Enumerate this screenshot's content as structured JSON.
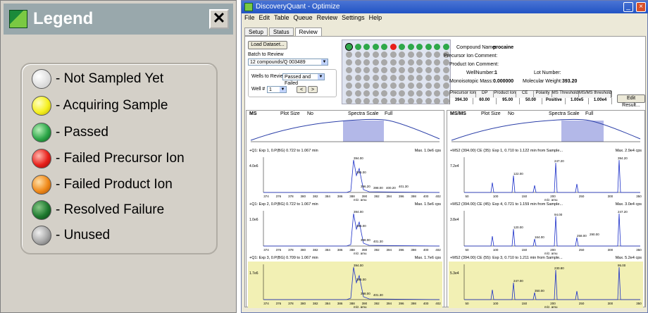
{
  "legend": {
    "title": "Legend",
    "close": "✕",
    "items": [
      {
        "label": "- Not Sampled Yet",
        "color": "#ffffff"
      },
      {
        "label": "- Acquiring Sample",
        "color": "#f5f020"
      },
      {
        "label": "- Passed",
        "color": "#2ea84a"
      },
      {
        "label": "- Failed Precursor Ion",
        "color": "#e8201a"
      },
      {
        "label": "- Failed Product Ion",
        "color": "#f08a1a"
      },
      {
        "label": "- Resolved Failure",
        "color": "#1f7a2f"
      },
      {
        "label": "- Unused",
        "color": "#a8a8a8"
      }
    ]
  },
  "app": {
    "title": "DiscoveryQuant - Optimize",
    "menu": [
      "File",
      "Edit",
      "Table",
      "Queue",
      "Review",
      "Settings",
      "Help"
    ],
    "tabs": [
      "Setup",
      "Status",
      "Review"
    ],
    "load_dataset": "Load Dataset...",
    "batch_label": "Batch to Review",
    "batch_value": "12 compounds/Q 003489",
    "wells_label": "Wells to Review",
    "wells_value": "Passed and Failed",
    "well_label": "Well #",
    "well_value": "1",
    "compound_label": "Compound Name:",
    "compound_value": "procaine",
    "precursor_comment": "Precursor Ion Comment:",
    "product_comment": "Product Ion Comment:",
    "well_number_label": "WellNumber:",
    "well_number_value": "1",
    "lot_label": "Lot Number:",
    "mono_label": "Monoisotopic Mass:",
    "mono_value": "0.000000",
    "mw_label": "Molecular Weight:",
    "mw_value": "393.20",
    "table_headers": [
      "Precursor Ion",
      "DP",
      "Product Ion",
      "CE",
      "Polarity",
      "MS Threshold",
      "MS/MS threshold"
    ],
    "table_values": [
      "394.30",
      "60.00",
      "95.00",
      "50.00",
      "Positive",
      "1.00e5",
      "1.00e4"
    ],
    "edit_result": "Edit Result...",
    "ms_panel": {
      "title": "MS",
      "plot_size": "Plot Size",
      "spectra_scale": "Spectra Scale",
      "full": "Full",
      "n": "No"
    },
    "msms_panel": {
      "title": "MS/MS",
      "plot_size": "Plot Size",
      "spectra_scale": "Spectra Scale",
      "full": "Full",
      "n": "No"
    },
    "ms_spectra": [
      {
        "header": "+Q1: Exp 1, 0.P(BG) 0.722 to 1.067 min",
        "max": "Max. 1.0e6 cps",
        "peaks": [
          "394.00",
          "395.00",
          "396.20",
          "398.00",
          "400.20",
          "401.30"
        ],
        "ylabel": "4.0e6"
      },
      {
        "header": "+Q1: Exp 2, 0.P(BG) 0.722 to 1.067 min",
        "max": "Max. 1.5e6 cps",
        "peaks": [
          "394.00",
          "395.00",
          "398.00",
          "401.30"
        ],
        "ylabel": "1.0e6"
      },
      {
        "header": "+Q1: Exp 3, 0.P(BG) 0.709 to 1.067 min",
        "max": "Max. 1.7e6 cps",
        "peaks": [
          "394.00",
          "395.00",
          "398.00",
          "401.30"
        ],
        "ylabel": "1.7e6"
      }
    ],
    "msms_spectra": [
      {
        "header": "+MS2 (394.00) CE (35): Exp 1, 0.710 to 1.122 min from Sample...",
        "max": "Max. 2.9e4 cps",
        "peaks": [
          "394.20",
          "247.20",
          "122.00"
        ],
        "ylabel": "7.2e4"
      },
      {
        "header": "+MS2 (394.00) CE (45): Exp 4, 0.721 to 1.159 min from Sample...",
        "max": "Max. 3.0e4 cps",
        "peaks": [
          "247.20",
          "94.00",
          "120.00",
          "164.00",
          "258.00",
          "290.00"
        ],
        "ylabel": "3.8e4"
      },
      {
        "header": "+MS2 (394.00) CE (55): Exp 3, 0.710 to 1.211 min from Sample...",
        "max": "Max. 5.2e4 cps",
        "peaks": [
          "95.00",
          "230.80",
          "247.00",
          "350.00"
        ],
        "ylabel": "5.3e4"
      }
    ],
    "x_axis_ms": [
      "374",
      "376",
      "378",
      "380",
      "382",
      "384",
      "386",
      "388",
      "390",
      "392",
      "394",
      "396",
      "398",
      "400",
      "402"
    ],
    "x_axis_msms": [
      "50",
      "100",
      "150",
      "200",
      "250",
      "300",
      "350"
    ],
    "x_unit": "m/z, amu"
  }
}
